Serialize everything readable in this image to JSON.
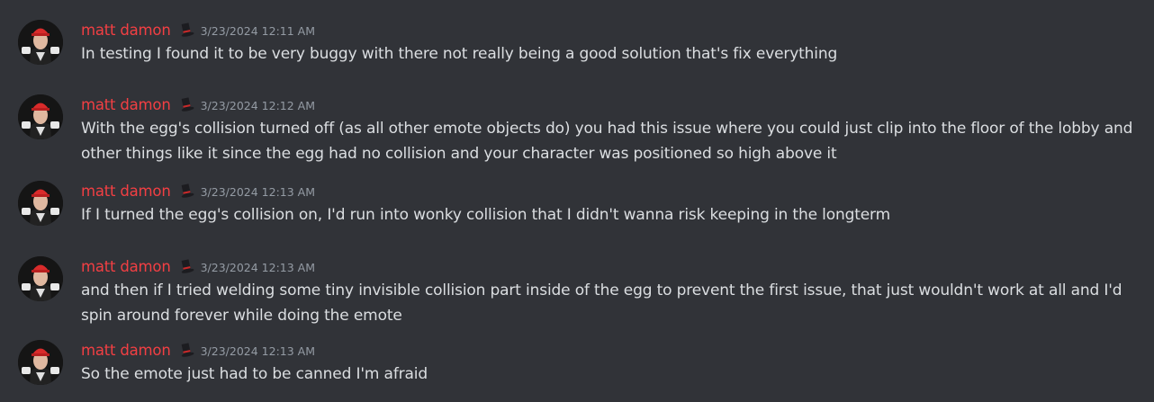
{
  "colors": {
    "background": "#313338",
    "username": "#f23f43",
    "timestamp": "#949ba4",
    "text": "#dbdee1"
  },
  "messages": [
    {
      "username": "matt damon",
      "badge_icon": "top-hat-icon",
      "timestamp": "3/23/2024 12:11 AM",
      "text": "In testing I found it to be very buggy with there not really being a good solution that's fix everything"
    },
    {
      "username": "matt damon",
      "badge_icon": "top-hat-icon",
      "timestamp": "3/23/2024 12:12 AM",
      "text": "With the egg's collision turned off (as all other emote objects do) you had this issue where you could just clip into the floor of the lobby and other things like it since the egg had no collision and your character was positioned so high above it"
    },
    {
      "username": "matt damon",
      "badge_icon": "top-hat-icon",
      "timestamp": "3/23/2024 12:13 AM",
      "text": "If I turned the egg's collision on, I'd run into wonky collision that I didn't wanna risk keeping in the longterm"
    },
    {
      "username": "matt damon",
      "badge_icon": "top-hat-icon",
      "timestamp": "3/23/2024 12:13 AM",
      "text": "and then if I tried welding some tiny invisible collision part inside of the egg to prevent the first issue, that just wouldn't work at all and I'd spin around forever while doing the emote"
    },
    {
      "username": "matt damon",
      "badge_icon": "top-hat-icon",
      "timestamp": "3/23/2024 12:13 AM",
      "text": "So the emote just had to be canned I'm afraid"
    }
  ]
}
